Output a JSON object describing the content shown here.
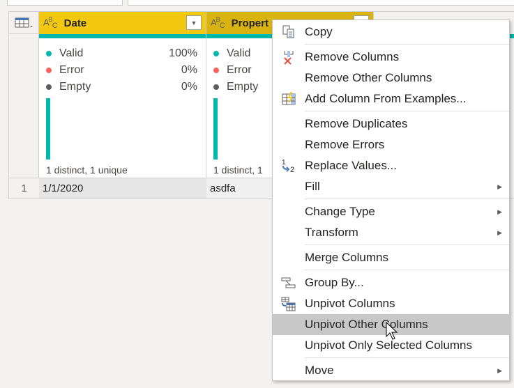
{
  "grid": {
    "columns": [
      {
        "name": "Date",
        "type_icon": "ABC",
        "stats": [
          {
            "label": "Valid",
            "value": "100%"
          },
          {
            "label": "Error",
            "value": "0%"
          },
          {
            "label": "Empty",
            "value": "0%"
          }
        ],
        "distinct": "1 distinct, 1 unique",
        "active": true
      },
      {
        "name": "Propert",
        "type_icon": "ABC",
        "stats": [
          {
            "label": "Valid",
            "value": ""
          },
          {
            "label": "Error",
            "value": ""
          },
          {
            "label": "Empty",
            "value": ""
          }
        ],
        "distinct": "1 distinct, 1",
        "active": false
      }
    ],
    "rows": [
      {
        "num": "1",
        "cells": [
          "1/1/2020",
          "asdfa"
        ]
      }
    ],
    "colors": {
      "valid": "#01b8aa",
      "error": "#fd625e",
      "empty": "#605e5c",
      "selected_header": "#f2c811"
    }
  },
  "menu": {
    "items": [
      {
        "label": "Copy",
        "icon": "copy-icon"
      },
      {
        "label": "Remove Columns",
        "icon": "remove-columns-icon"
      },
      {
        "label": "Remove Other Columns"
      },
      {
        "label": "Add Column From Examples...",
        "icon": "add-column-examples-icon"
      },
      {
        "label": "Remove Duplicates"
      },
      {
        "label": "Remove Errors"
      },
      {
        "label": "Replace Values...",
        "icon": "replace-values-icon"
      },
      {
        "label": "Fill",
        "submenu": true
      },
      {
        "label": "Change Type",
        "submenu": true
      },
      {
        "label": "Transform",
        "submenu": true
      },
      {
        "label": "Merge Columns"
      },
      {
        "label": "Group By...",
        "icon": "group-by-icon"
      },
      {
        "label": "Unpivot Columns",
        "icon": "unpivot-icon"
      },
      {
        "label": "Unpivot Other Columns",
        "highlighted": true
      },
      {
        "label": "Unpivot Only Selected Columns"
      },
      {
        "label": "Move",
        "submenu": true
      }
    ]
  }
}
